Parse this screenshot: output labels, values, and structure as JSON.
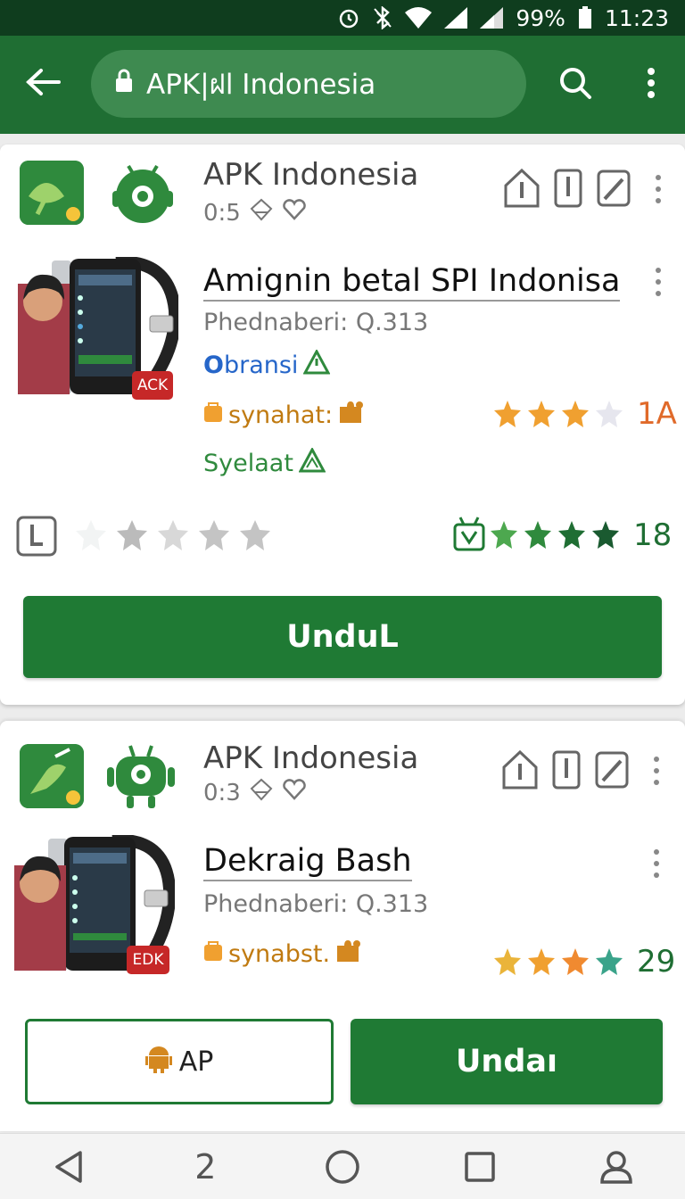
{
  "status_bar": {
    "battery": "99%",
    "time": "11:23",
    "icons": [
      "alarm-icon",
      "bluetooth-off-icon",
      "wifi-icon",
      "signal-icon",
      "signal-icon",
      "battery-icon"
    ]
  },
  "app_bar": {
    "url_text": "APK|ฝl Indonesia",
    "icons": [
      "back-arrow-icon",
      "lock-icon",
      "search-icon",
      "more-vert-icon"
    ]
  },
  "cards": [
    {
      "publisher": "APK Indonesia",
      "meta": "0:5",
      "title": "Amignin betal SPI Indonisa",
      "developer": "Phednaberi: Q.313",
      "brand_tag": "bransi",
      "brand_tag_prefix": "O",
      "category_tag": "synahat:",
      "category_rating": "1A",
      "extra_tag": "Syelaat",
      "badge": "ACK",
      "bottom_rating": "18",
      "primary_button": "UnduL"
    },
    {
      "publisher": "APK Indonesia",
      "meta": "0:3",
      "title": "Dekraig Bash",
      "developer": "Phednaberi: Q.313",
      "category_tag": "synabst.",
      "category_rating": "29",
      "badge": "EDK",
      "secondary_button": "AP",
      "primary_button": "Undaı"
    }
  ],
  "colors": {
    "status_bar": "#0f3d1e",
    "app_bar": "#1f6e33",
    "primary": "#1f7a34",
    "star_orange": "#f0a030",
    "star_green": "#2f8a3d"
  },
  "nav_bar": {
    "icons": [
      "back-triangle-icon",
      "two-icon",
      "home-circle-icon",
      "recents-square-icon",
      "profile-icon"
    ],
    "second_label": "2"
  }
}
